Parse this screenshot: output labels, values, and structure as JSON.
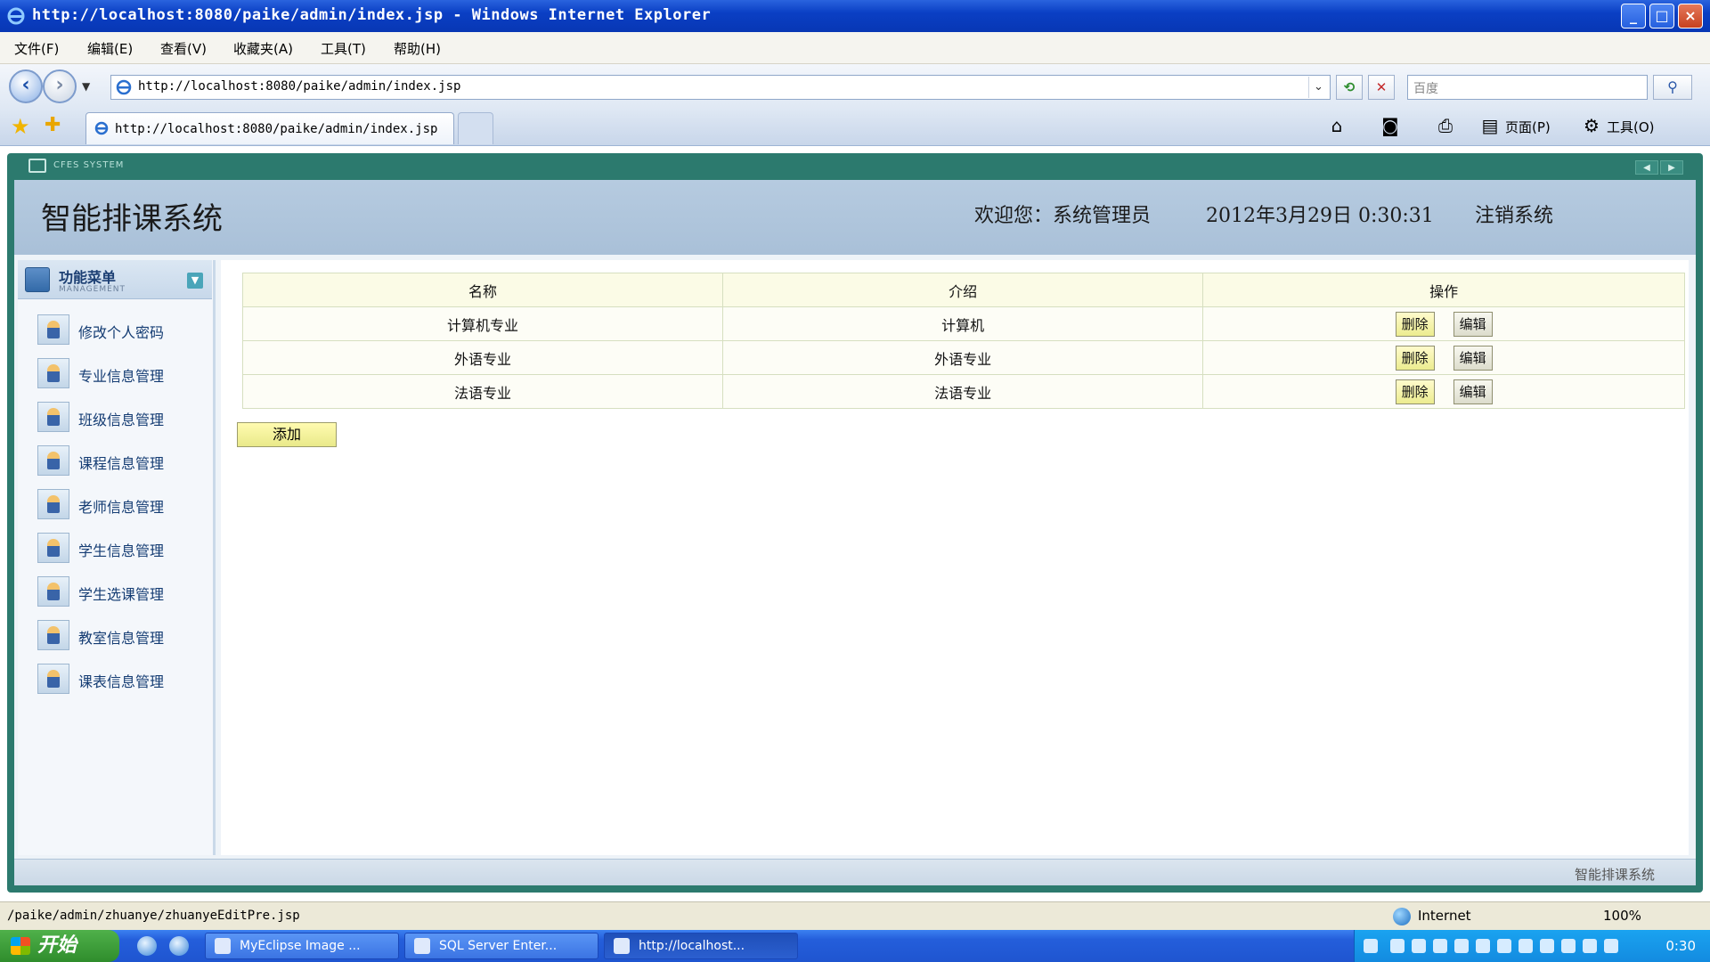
{
  "window": {
    "title": "http://localhost:8080/paike/admin/index.jsp - Windows Internet Explorer",
    "controls": [
      "_",
      "□",
      "×"
    ]
  },
  "menubar": [
    "文件(F)",
    "编辑(E)",
    "查看(V)",
    "收藏夹(A)",
    "工具(T)",
    "帮助(H)"
  ],
  "address": {
    "url": "http://localhost:8080/paike/admin/index.jsp",
    "search_placeholder": "百度"
  },
  "tab": {
    "label": "http://localhost:8080/paike/admin/index.jsp"
  },
  "commandbar": {
    "page": "页面(P)",
    "tools": "工具(O)"
  },
  "app": {
    "system_label": "CFES SYSTEM",
    "title": "智能排课系统",
    "welcome": "欢迎您：系统管理员",
    "datetime": "2012年3月29日  0:30:31",
    "logout": "注销系统",
    "footer": "智能排课系统"
  },
  "sidebar": {
    "title": "功能菜单",
    "subtitle": "MANAGEMENT",
    "items": [
      {
        "label": "修改个人密码"
      },
      {
        "label": "专业信息管理"
      },
      {
        "label": "班级信息管理"
      },
      {
        "label": "课程信息管理"
      },
      {
        "label": "老师信息管理"
      },
      {
        "label": "学生信息管理"
      },
      {
        "label": "学生选课管理"
      },
      {
        "label": "教室信息管理"
      },
      {
        "label": "课表信息管理"
      }
    ]
  },
  "table": {
    "headers": [
      "名称",
      "介绍",
      "操作"
    ],
    "rows": [
      {
        "name": "计算机专业",
        "intro": "计算机",
        "delete": "删除",
        "edit": "编辑"
      },
      {
        "name": "外语专业",
        "intro": "外语专业",
        "delete": "删除",
        "edit": "编辑"
      },
      {
        "name": "法语专业",
        "intro": "法语专业",
        "delete": "删除",
        "edit": "编辑"
      }
    ],
    "add_label": "添加"
  },
  "statusbar": {
    "url": "/paike/admin/zhuanye/zhuanyeEditPre.jsp",
    "zone": "Internet",
    "zoom": "100%"
  },
  "taskbar": {
    "start": "开始",
    "tasks": [
      {
        "label": "MyEclipse Image ..."
      },
      {
        "label": "SQL Server Enter..."
      },
      {
        "label": "http://localhost..."
      }
    ],
    "clock": "0:30"
  },
  "colors": {
    "app_frame": "#2c7a6e",
    "header_bg": "#b6cbe0",
    "menu_text": "#143c73",
    "delete_btn": "#ecec8f"
  }
}
